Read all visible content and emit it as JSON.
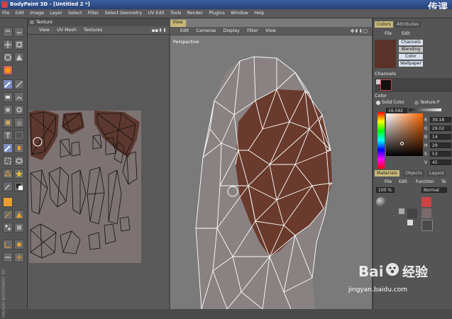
{
  "window": {
    "title": "BodyPaint 3D - [Untitled 2 *]",
    "watermark": "传课"
  },
  "menubar": [
    "File",
    "Edit",
    "Image",
    "Layer",
    "Select",
    "Filter",
    "Select Geometry",
    "UV Edit",
    "Tools",
    "Render",
    "Plugins",
    "Window",
    "Help"
  ],
  "texture_panel": {
    "title": "Texture",
    "menu": [
      "View",
      "UV Mesh",
      "Textures"
    ]
  },
  "viewport": {
    "tab": "View",
    "menu": [
      "Edit",
      "Cameras",
      "Display",
      "Filter",
      "View"
    ],
    "camera_label": "Perspective"
  },
  "toolbar": {
    "vertical_label": "MAXON BODYPAINT 3D"
  },
  "colors_panel": {
    "tabs": [
      "Colors",
      "Attributes"
    ],
    "menu": [
      "File",
      "Edit"
    ],
    "channels_list": [
      "Channels",
      "Blending",
      "Color",
      "Wallpaper"
    ],
    "channels_header": "Channels",
    "color_header": "Color",
    "mode_solid": "Solid Color",
    "mode_texture": "Texture P",
    "value_field": "16.592 %",
    "hsv_labels": [
      "R",
      "G",
      "B",
      "H",
      "S",
      "V"
    ],
    "hsv_values": [
      "39.18",
      "29.02",
      "14",
      "29",
      "53",
      "45"
    ]
  },
  "materials_panel": {
    "tabs": [
      "Materials",
      "Objects",
      "Layers"
    ],
    "menu": [
      "File",
      "Edit",
      "Function",
      "Te"
    ],
    "percent_field": "100 %",
    "blend_mode": "Normal"
  },
  "footer": {
    "brand_text": "经验",
    "url": "jingyan.baidu.com"
  },
  "accent_colors": {
    "title_bar": "#2f4f8c",
    "active_tab": "#c8b878",
    "paint_brown": "#5a3228"
  }
}
